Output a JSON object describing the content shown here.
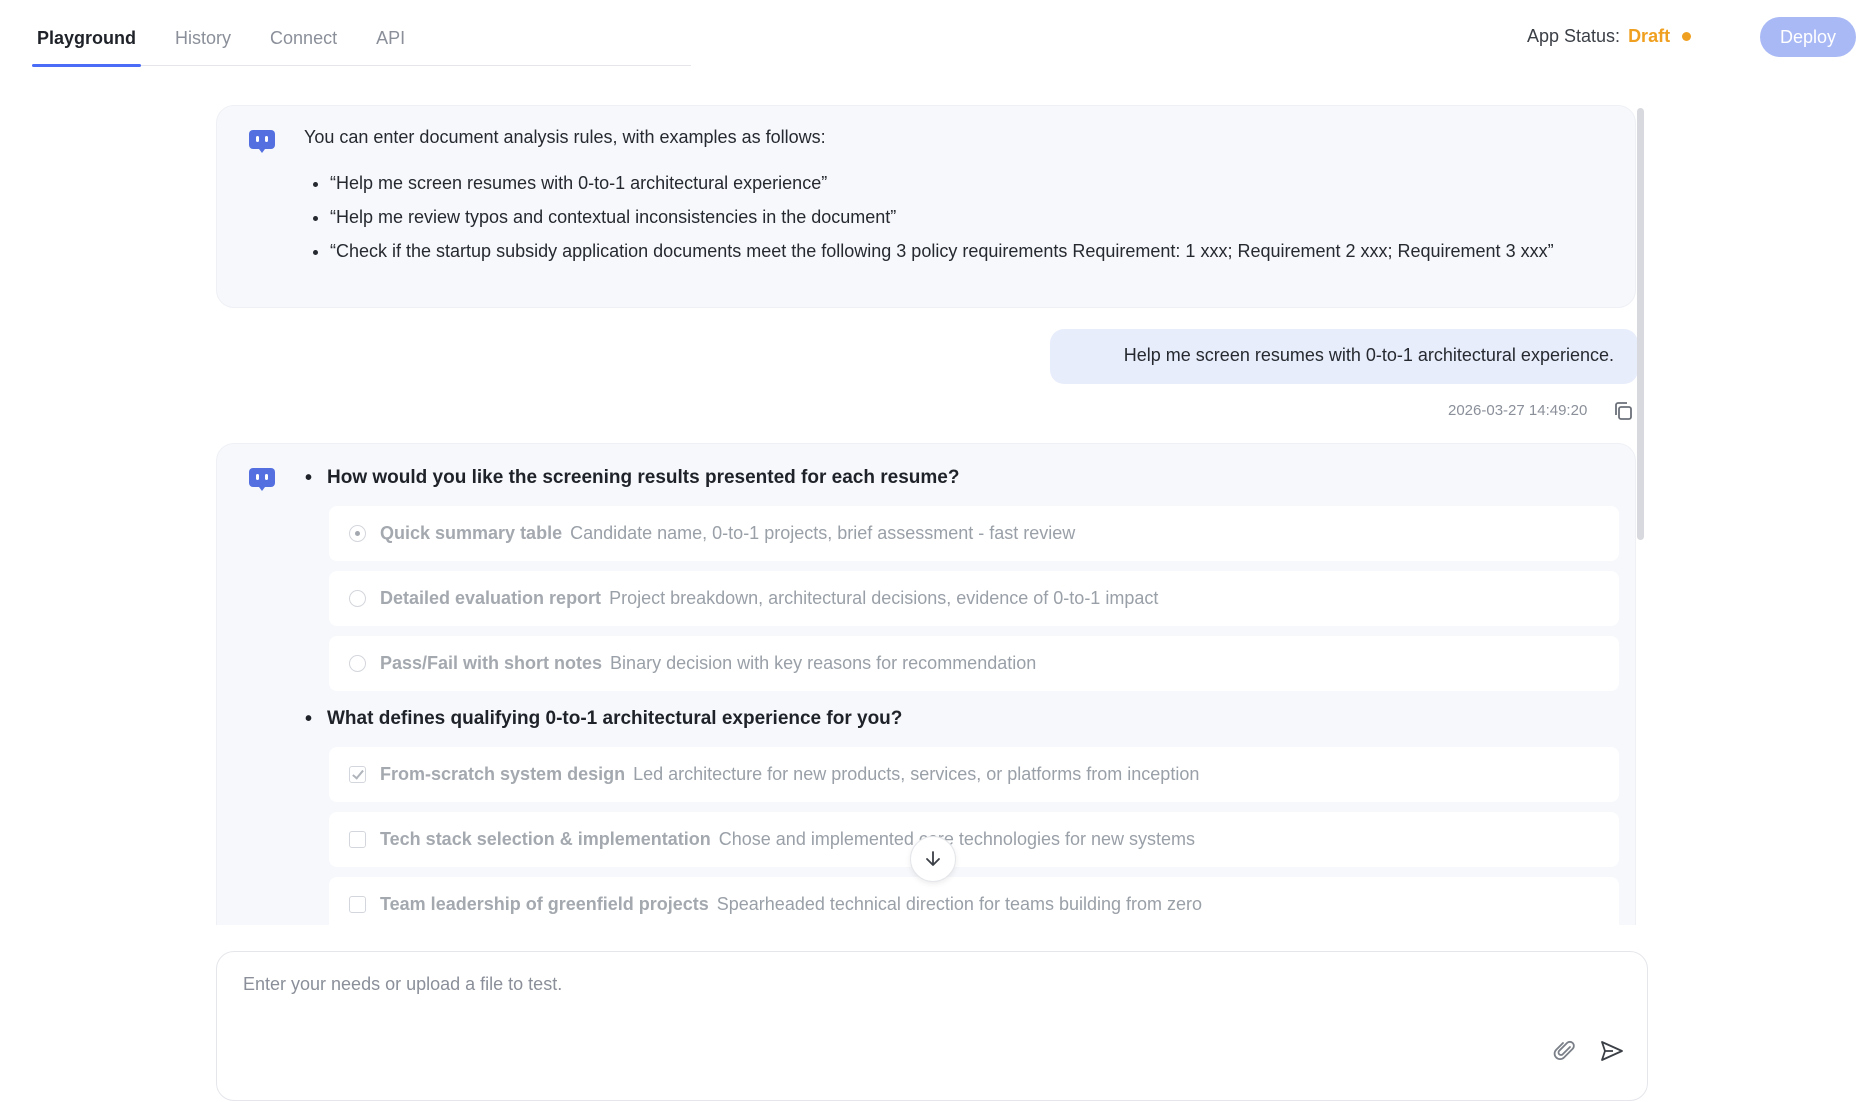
{
  "tabs": [
    "Playground",
    "History",
    "Connect",
    "API"
  ],
  "status": {
    "label": "App Status:",
    "value": "Draft",
    "color": "#f0a020"
  },
  "deploy_label": "Deploy",
  "intro": {
    "text": "You can enter document analysis rules, with examples as follows:",
    "examples": [
      "“Help me screen resumes with 0-to-1 architectural experience”",
      "“Help me review typos and contextual inconsistencies in the document”",
      "“Check if the startup subsidy application documents meet the following 3 policy requirements Requirement: 1 xxx; Requirement 2 xxx; Requirement 3 xxx”"
    ]
  },
  "user_message": "Help me screen resumes with 0-to-1 architectural experience.",
  "timestamp": "2026-03-27 14:49:20",
  "questions": [
    {
      "text": "How would you like the screening results presented for each resume?",
      "type": "radio",
      "options": [
        {
          "title": "Quick summary table",
          "desc": "Candidate name, 0-to-1 projects, brief assessment - fast review",
          "checked": true
        },
        {
          "title": "Detailed evaluation report",
          "desc": "Project breakdown, architectural decisions, evidence of 0-to-1 impact",
          "checked": false
        },
        {
          "title": "Pass/Fail with short notes",
          "desc": "Binary decision with key reasons for recommendation",
          "checked": false
        }
      ]
    },
    {
      "text": "What defines qualifying 0-to-1 architectural experience for you?",
      "type": "checkbox",
      "options": [
        {
          "title": "From-scratch system design",
          "desc": "Led architecture for new products, services, or platforms from inception",
          "checked": true
        },
        {
          "title": "Tech stack selection & implementation",
          "desc": "Chose and implemented core technologies for new systems",
          "checked": false
        },
        {
          "title": "Team leadership of greenfield projects",
          "desc": "Spearheaded technical direction for teams building from zero",
          "checked": false
        }
      ]
    }
  ],
  "input_placeholder": "Enter your needs or upload a file to test.",
  "icons": {
    "bot": "bot-avatar-icon",
    "copy": "copy-icon",
    "scroll": "arrow-down-icon",
    "attach": "paperclip-icon",
    "send": "send-icon"
  },
  "accent_color": "#4a6cf7"
}
